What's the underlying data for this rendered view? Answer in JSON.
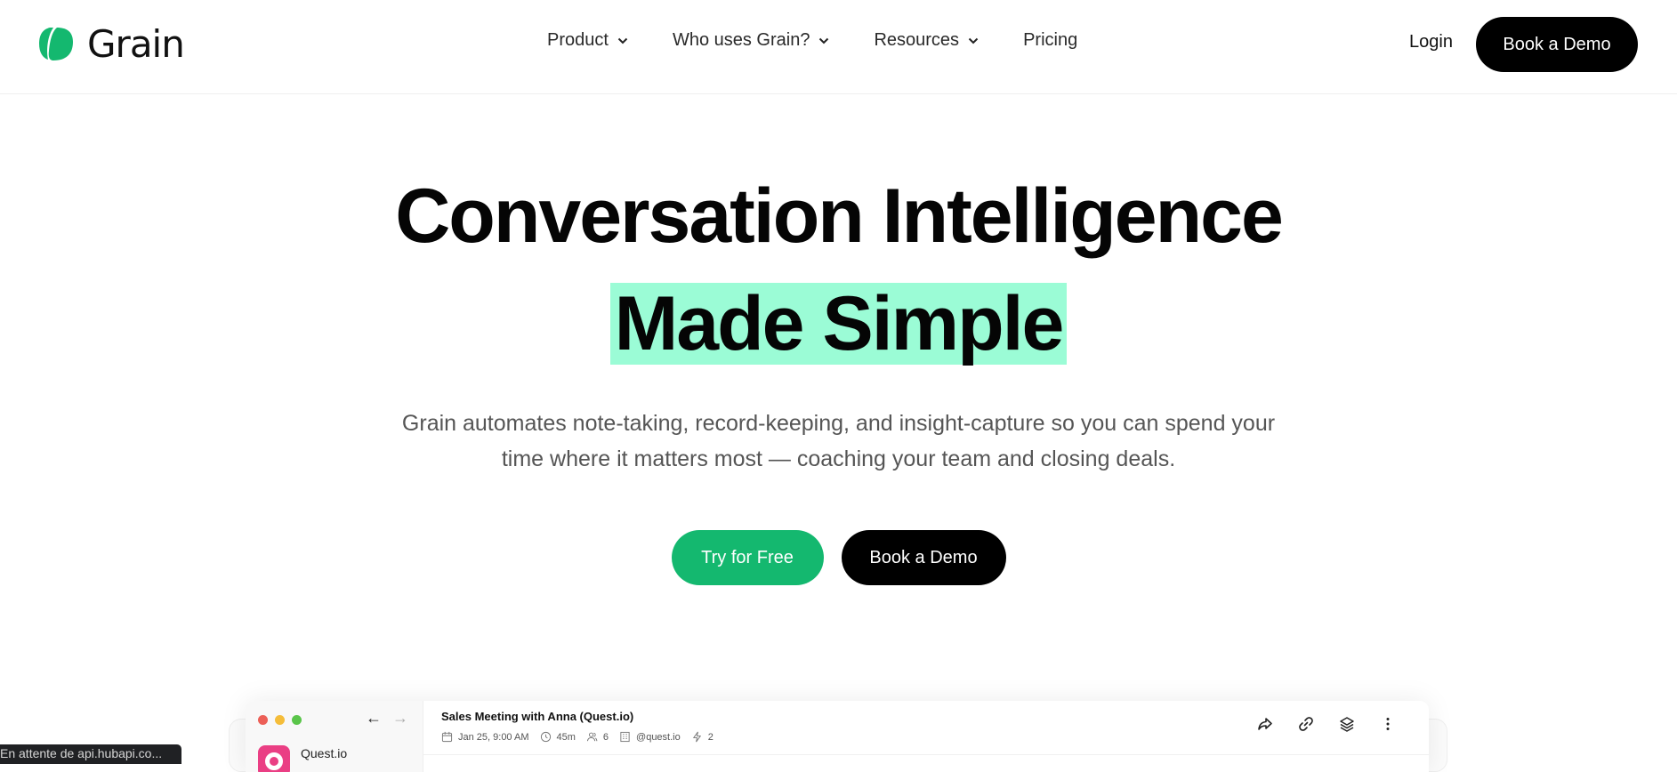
{
  "brand": {
    "name": "Grain",
    "color": "#14b86f"
  },
  "nav": {
    "items": [
      {
        "label": "Product",
        "has_dropdown": true
      },
      {
        "label": "Who uses Grain?",
        "has_dropdown": true
      },
      {
        "label": "Resources",
        "has_dropdown": true
      },
      {
        "label": "Pricing",
        "has_dropdown": false
      }
    ],
    "login_label": "Login",
    "book_demo_label": "Book a Demo"
  },
  "hero": {
    "title_line1": "Conversation Intelligence",
    "title_line2": "Made Simple",
    "highlight_color": "#9bfcd6",
    "subtitle_line1": "Grain automates note-taking, record-keeping, and insight-capture so you can spend your",
    "subtitle_line2": "time where it matters most — coaching your team and closing deals.",
    "cta_primary": "Try for Free",
    "cta_secondary": "Book a Demo"
  },
  "app_preview": {
    "workspace_name": "Quest.io",
    "meeting_title": "Sales Meeting with Anna (Quest.io)",
    "meta": {
      "date": "Jan 25, 9:00 AM",
      "duration": "45m",
      "participants": "6",
      "domain": "@quest.io",
      "highlights": "2"
    },
    "toolbar_icons": [
      "share-icon",
      "link-icon",
      "layers-icon",
      "more-icon"
    ]
  },
  "browser_status": "En attente de api.hubapi.co..."
}
